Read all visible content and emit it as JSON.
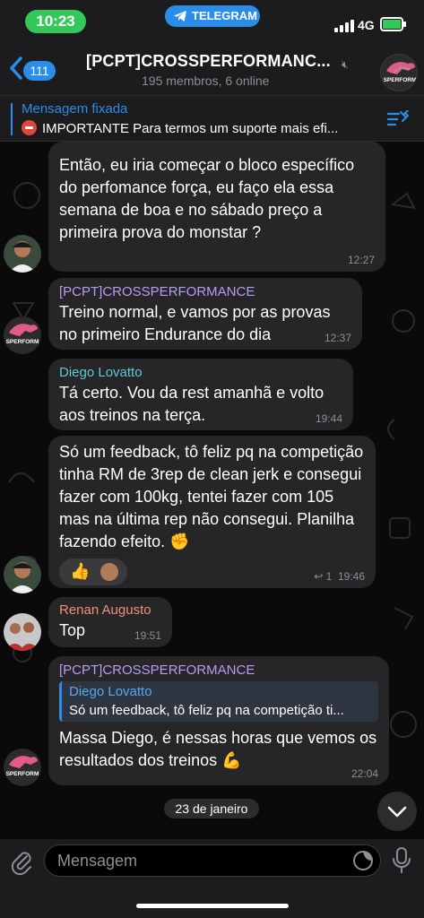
{
  "status_bar": {
    "time": "10:23",
    "app_name": "TELEGRAM",
    "network": "4G"
  },
  "header": {
    "back_count": "111",
    "title": "[PCPT]CROSSPERFORMANC...",
    "subtitle": "195 membros, 6 online",
    "avatar_text": "SPERFORM"
  },
  "pinned": {
    "title": "Mensagem fixada",
    "text": "IMPORTANTE Para termos um suporte mais efi..."
  },
  "messages": [
    {
      "text": "Então, eu iria começar o bloco específico do perfomance força, eu faço ela essa semana de boa e no sábado preço a primeira prova do monstar ?",
      "time": "12:27"
    },
    {
      "sender": "[PCPT]CROSSPERFORMANCE",
      "text": "Treino normal, e vamos por as provas no primeiro Endurance do dia",
      "time": "12:37",
      "avatar_text": "SPERFORM"
    },
    {
      "sender": "Diego Lovatto",
      "text": "Tá certo. Vou da rest amanhã e volto aos treinos na terça.",
      "time": "19:44"
    },
    {
      "text": "Só um feedback, tô feliz pq na competição tinha RM de 3rep de clean jerk e consegui fazer com 100kg, tentei fazer com 105 mas na última rep não consegui. Planilha fazendo efeito.",
      "reply_count": "1",
      "time": "19:46"
    },
    {
      "sender": "Renan Augusto",
      "text": "Top",
      "time": "19:51"
    },
    {
      "sender": "[PCPT]CROSSPERFORMANCE",
      "quote_name": "Diego Lovatto",
      "quote_text": "Só um feedback, tô feliz pq na competição ti...",
      "text": "Massa Diego, é nessas horas que vemos os resultados dos treinos",
      "time": "22:04",
      "avatar_text": "SPERFORM"
    }
  ],
  "date_divider": "23 de janeiro",
  "input": {
    "placeholder": "Mensagem"
  },
  "colors": {
    "accent": "#2a8ee8",
    "bubble": "#262628",
    "time_pill": "#34c759",
    "name_purple": "#b79cf0",
    "name_teal": "#5ec8d6",
    "name_red": "#f0907a"
  }
}
